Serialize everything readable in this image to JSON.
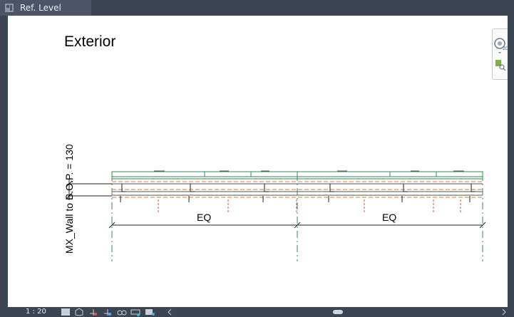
{
  "tab": {
    "label": "Ref. Level",
    "icon": "floor-plan-view-icon"
  },
  "view": {
    "title": "Exterior",
    "dimension_label": "MX_Wall to B.O.P. = 130",
    "eq_left": "EQ",
    "eq_right": "EQ"
  },
  "statusbar": {
    "scale": "1 : 20",
    "icons": [
      "detail-level-icon",
      "visual-style-icon",
      "sun-path-icon",
      "shadows-icon",
      "temporary-hide-icon",
      "reveal-hidden-icon",
      "crop-view-icon",
      "scroll-left-icon",
      "scroll-right-icon"
    ]
  },
  "navigation_bar": {
    "icons": [
      "steering-wheel-icon",
      "zoom-icon"
    ]
  },
  "colors": {
    "frame": "#3b4453",
    "tab": "#4b5568",
    "green": "#2e8b57",
    "orange": "#e07a2e",
    "red": "#d9534f"
  }
}
